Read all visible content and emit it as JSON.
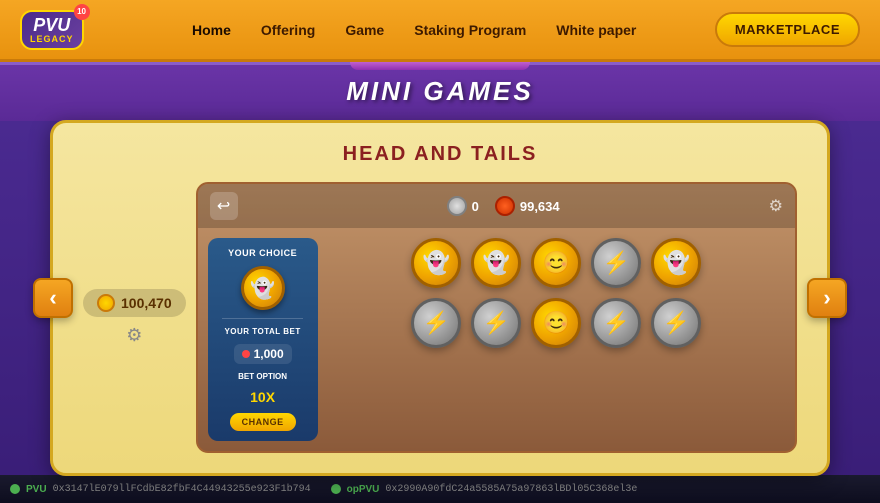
{
  "navbar": {
    "logo": {
      "pvu": "PVU",
      "legacy": "LEGACY",
      "badge": "10"
    },
    "links": [
      {
        "label": "Home",
        "active": true
      },
      {
        "label": "Offering",
        "active": false
      },
      {
        "label": "Game",
        "active": false
      },
      {
        "label": "Staking Program",
        "active": false
      },
      {
        "label": "White paper",
        "active": false
      }
    ],
    "marketplace_btn": "MARKETPLACE"
  },
  "mini_games_banner": {
    "title": "MINI GAMES"
  },
  "game_card": {
    "title": "HEAD AND TAILS",
    "left_score": {
      "value": "100,470",
      "icon_label": "coin-icon"
    },
    "game_panel": {
      "back_icon": "‹",
      "score_silver": "0",
      "score_fire": "99,634",
      "choice_label": "YOUR CHOICE",
      "total_bet_label": "YOUR TOTAL BET",
      "bet_value": "1,000",
      "bet_option_label": "BET OPTION",
      "bet_option_value": "10X",
      "change_btn": "CHANGE"
    },
    "coins": [
      [
        "gold-face",
        "gold-face",
        "gold-face",
        "silver-bolt",
        "gold-face"
      ],
      [
        "silver-bolt",
        "silver-bolt",
        "gold-face",
        "silver-bolt",
        "silver-bolt"
      ]
    ]
  },
  "nav_arrows": {
    "left": "‹",
    "right": "›"
  },
  "bottom_bar": {
    "pvu_label": "PVU",
    "pvu_address": "0x3147lE079llFCdbE82fbF4C44943255e923F1b794",
    "oppvu_label": "opPVU",
    "oppvu_address": "0x2990A90fdC24a5585A75a97863lBDl05C368el3e"
  }
}
